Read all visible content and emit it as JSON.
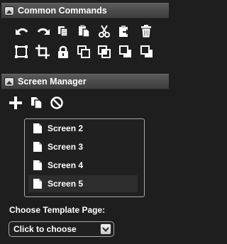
{
  "common_commands": {
    "title": "Common Commands",
    "row1_icons": [
      "undo-icon",
      "redo-icon",
      "copy-icon",
      "paste-icon",
      "cut-icon",
      "paste-special-icon",
      "delete-icon"
    ],
    "row2_icons": [
      "select-all-icon",
      "crop-icon",
      "lock-icon",
      "bring-to-front-icon",
      "bring-forward-icon",
      "send-backward-icon",
      "send-to-back-icon"
    ]
  },
  "screen_manager": {
    "title": "Screen Manager",
    "toolbar_icons": [
      "add-screen-icon",
      "duplicate-screen-icon",
      "no-screen-icon"
    ],
    "screens": [
      {
        "label": "Screen 2",
        "selected": false
      },
      {
        "label": "Screen 3",
        "selected": false
      },
      {
        "label": "Screen 4",
        "selected": false
      },
      {
        "label": "Screen 5",
        "selected": true
      }
    ]
  },
  "template": {
    "label": "Choose Template Page:",
    "select_value": "Click to choose"
  },
  "colors": {
    "background": "#1e1e1e",
    "header": "#4a4a4a",
    "text": "#ffffff",
    "border": "#a7a7a7"
  }
}
